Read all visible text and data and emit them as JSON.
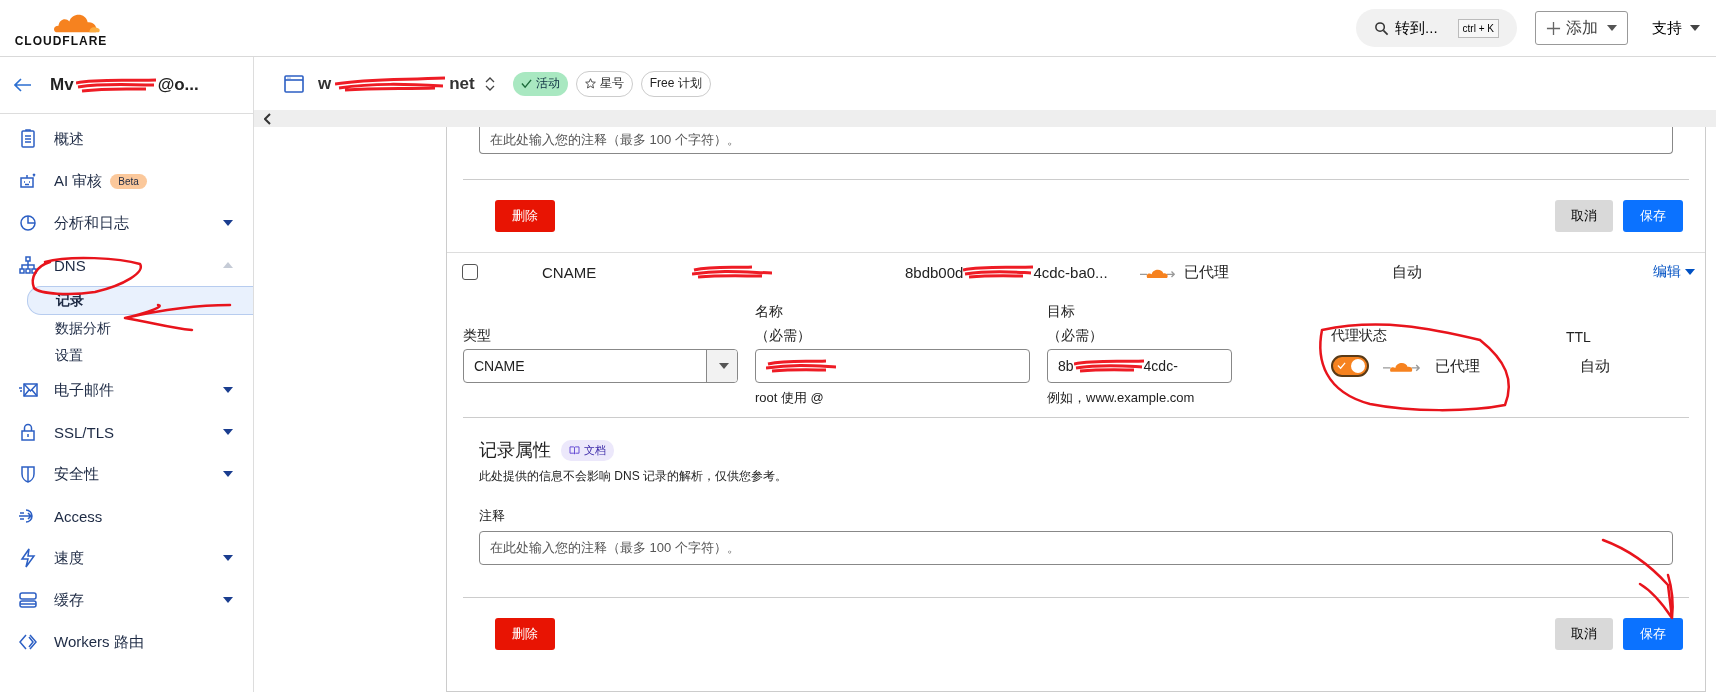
{
  "header": {
    "logo": "CLOUDFLARE",
    "search": {
      "label": "转到...",
      "shortcut": "ctrl + K"
    },
    "add_button": "添加",
    "support": "支持"
  },
  "account": {
    "parts": [
      "Mv",
      "@o..."
    ]
  },
  "domain": {
    "parts": [
      "w",
      "net"
    ],
    "badges": [
      {
        "label": "活动",
        "kind": "status"
      },
      {
        "label": "星号",
        "kind": "star"
      },
      {
        "label": "Free 计划",
        "kind": "plan"
      }
    ]
  },
  "sidebar": {
    "items": [
      {
        "label": "概述",
        "kind": "link"
      },
      {
        "label": "AI 审核",
        "kind": "link",
        "badge": "Beta"
      },
      {
        "label": "分析和日志",
        "kind": "group",
        "expanded": false
      },
      {
        "label": "DNS",
        "kind": "group",
        "expanded": true,
        "children": [
          {
            "label": "记录",
            "selected": true
          },
          {
            "label": "数据分析",
            "selected": false
          },
          {
            "label": "设置",
            "selected": false
          }
        ]
      },
      {
        "label": "电子邮件",
        "kind": "group",
        "expanded": false
      },
      {
        "label": "SSL/TLS",
        "kind": "group",
        "expanded": false
      },
      {
        "label": "安全性",
        "kind": "group",
        "expanded": false
      },
      {
        "label": "Access",
        "kind": "link"
      },
      {
        "label": "速度",
        "kind": "group",
        "expanded": false
      },
      {
        "label": "缓存",
        "kind": "group",
        "expanded": false
      },
      {
        "label": "Workers 路由",
        "kind": "link"
      }
    ]
  },
  "top_card": {
    "note_placeholder": "在此处输入您的注释（最多 100 个字符）。",
    "delete": "删除",
    "cancel": "取消",
    "save": "保存"
  },
  "record": {
    "checked": false,
    "type": "CNAME",
    "content_parts": [
      "8bdb00d",
      "4cdc-ba0..."
    ],
    "proxy_status": "已代理",
    "ttl": "自动",
    "edit": "编辑"
  },
  "edit_form": {
    "type": {
      "label": "类型",
      "value": "CNAME"
    },
    "name": {
      "label": "名称",
      "required": "（必需）",
      "hint": "root 使用 @"
    },
    "target": {
      "label": "目标",
      "required": "（必需）",
      "value_parts": [
        "8b",
        "4cdc-"
      ],
      "hint": "例如，www.example.com"
    },
    "proxy": {
      "label": "代理状态",
      "on": true,
      "text": "已代理"
    },
    "ttl": {
      "label": "TTL",
      "value": "自动"
    }
  },
  "attributes": {
    "title": "记录属性",
    "doc_link": "文档",
    "description": "此处提供的信息不会影响 DNS 记录的解析，仅供您参考。",
    "note_label": "注释",
    "note_placeholder": "在此处输入您的注释（最多 100 个字符）。",
    "delete": "删除",
    "cancel": "取消",
    "save": "保存"
  }
}
